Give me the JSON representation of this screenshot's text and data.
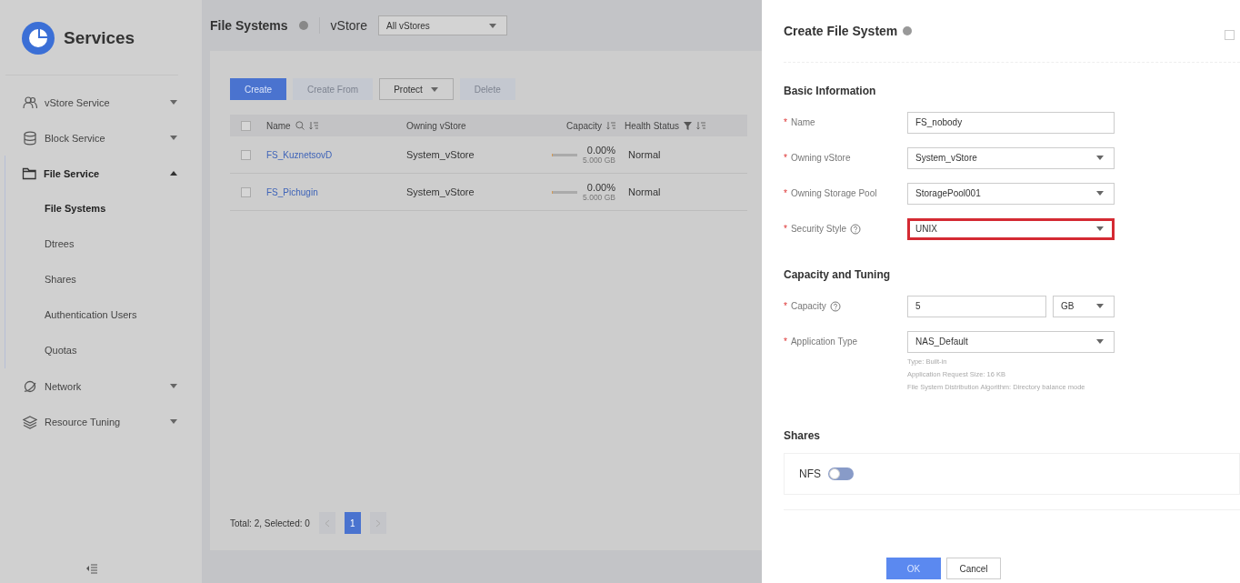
{
  "sidebar": {
    "title": "Services",
    "items": [
      {
        "label": "vStore Service",
        "expanded": false
      },
      {
        "label": "Block Service",
        "expanded": false
      },
      {
        "label": "File Service",
        "expanded": true,
        "children": [
          {
            "label": "File Systems",
            "selected": true
          },
          {
            "label": "Dtrees",
            "selected": false
          },
          {
            "label": "Shares",
            "selected": false
          },
          {
            "label": "Authentication Users",
            "selected": false
          },
          {
            "label": "Quotas",
            "selected": false
          }
        ]
      },
      {
        "label": "Network",
        "expanded": false
      },
      {
        "label": "Resource Tuning",
        "expanded": false
      }
    ]
  },
  "list": {
    "title": "File Systems",
    "vstore_label": "vStore",
    "vstore_value": "All vStores",
    "toolbar": [
      {
        "label": "Create",
        "kind": "primary",
        "disabled": false
      },
      {
        "label": "Create From",
        "kind": "plain",
        "disabled": true
      },
      {
        "label": "Protect",
        "kind": "dropdown",
        "disabled": false
      },
      {
        "label": "Delete",
        "kind": "plain",
        "disabled": true
      }
    ],
    "all_checked": false,
    "columns": [
      {
        "label": "Name",
        "search": true,
        "sort": true
      },
      {
        "label": "Owning vStore"
      },
      {
        "label": "Capacity",
        "sort": true
      },
      {
        "label": "Health Status",
        "sort": true,
        "filter": true
      }
    ],
    "rows": [
      {
        "checked": false,
        "name": "FS_KuznetsovD",
        "vstore": "System_vStore",
        "level": 0.0,
        "percent": "0.00%",
        "size": "5.000 GB",
        "health": "Normal"
      },
      {
        "checked": false,
        "name": "FS_Pichugin",
        "vstore": "System_vStore",
        "level": 0.0,
        "percent": "0.00%",
        "size": "5.000 GB",
        "health": "Normal"
      }
    ],
    "pagination": {
      "summary": "Total: 2, Selected: 0",
      "pages": [
        {
          "label": "1",
          "selected": true
        }
      ]
    }
  },
  "drawer": {
    "title": "Create File System",
    "corner_checked": false,
    "sections": [
      {
        "title": "Basic Information",
        "fields": [
          {
            "required_mark": "*",
            "label": "Name",
            "kind": "input",
            "value": "FS_nobody",
            "help": false,
            "highlighted": false
          },
          {
            "required_mark": "*",
            "label": "Owning vStore",
            "kind": "select",
            "value": "System_vStore",
            "help": false,
            "highlighted": false
          },
          {
            "required_mark": "*",
            "label": "Owning Storage Pool",
            "kind": "select",
            "value": "StoragePool001",
            "help": false,
            "highlighted": false
          },
          {
            "required_mark": "*",
            "label": "Security Style",
            "kind": "select",
            "value": "UNIX",
            "help": true,
            "highlighted": true
          }
        ]
      },
      {
        "title": "Capacity and Tuning",
        "fields": [
          {
            "required_mark": "*",
            "label": "Capacity",
            "kind": "unit",
            "value": "5",
            "unit": "GB",
            "help": true,
            "highlighted": false
          },
          {
            "required_mark": "*",
            "label": "Application Type",
            "kind": "select",
            "value": "NAS_Default",
            "help": false,
            "highlighted": false,
            "hints": [
              "Type: Built-in",
              "Application Request Size: 16 KB",
              "File System Distribution Algorithm: Directory balance mode"
            ]
          }
        ]
      }
    ],
    "shares_title": "Shares",
    "shares": [
      {
        "label": "NFS",
        "on": false
      }
    ],
    "buttons": [
      {
        "label": "OK",
        "kind": "primary"
      },
      {
        "label": "Cancel",
        "kind": "plain"
      }
    ]
  }
}
